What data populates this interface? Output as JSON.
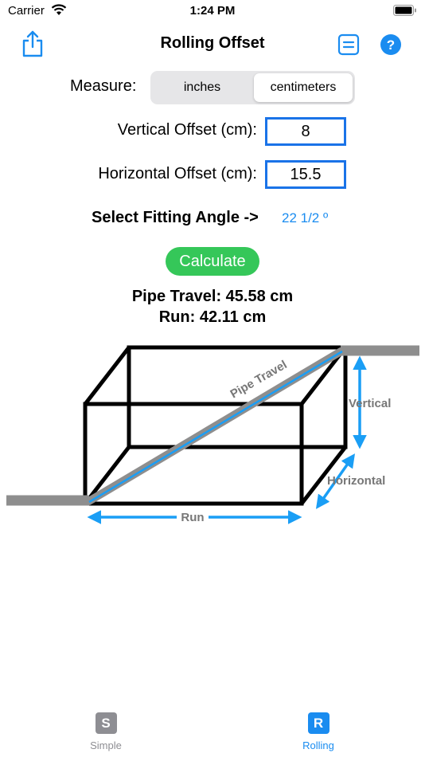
{
  "status": {
    "carrier": "Carrier",
    "time": "1:24 PM"
  },
  "nav": {
    "title": "Rolling Offset",
    "icons": {
      "share": "share-icon",
      "list": "list-icon",
      "help": "help-icon"
    },
    "help_glyph": "?"
  },
  "measure": {
    "label": "Measure:",
    "options": [
      "inches",
      "centimeters"
    ],
    "selected": "centimeters"
  },
  "fields": {
    "vertical": {
      "label": "Vertical Offset (cm):",
      "value": "8"
    },
    "horizontal": {
      "label": "Horizontal Offset (cm):",
      "value": "15.5"
    }
  },
  "angle": {
    "label": "Select Fitting Angle ->",
    "value": "22 1/2 º"
  },
  "calculate_label": "Calculate",
  "results": {
    "pipe_travel": "Pipe Travel: 45.58 cm",
    "run": "Run: 42.11 cm"
  },
  "diagram": {
    "labels": {
      "pipe_travel": "Pipe Travel",
      "vertical": "Vertical",
      "horizontal": "Horizontal",
      "run": "Run"
    }
  },
  "tabs": [
    {
      "glyph": "S",
      "label": "Simple",
      "active": false
    },
    {
      "glyph": "R",
      "label": "Rolling",
      "active": true
    }
  ],
  "colors": {
    "accent": "#1a8cf0",
    "field_border": "#1a73e8",
    "calculate": "#35c759",
    "pipe": "#8e8e8e",
    "inactive_tab": "#8e8e93"
  }
}
